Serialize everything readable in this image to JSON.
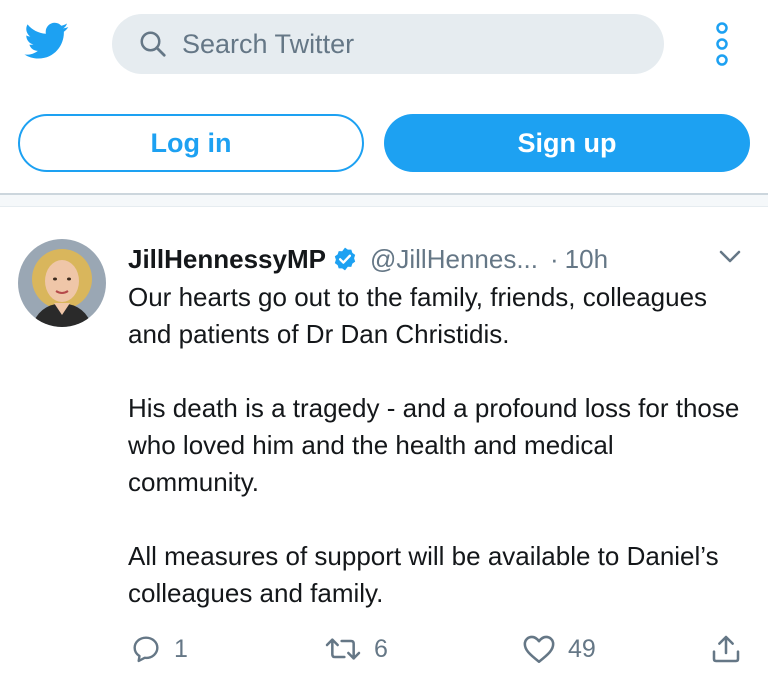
{
  "colors": {
    "brand": "#1da1f2",
    "text": "#14171a",
    "secondary": "#657786",
    "search_bg": "#e6ecf0"
  },
  "topbar": {
    "logo_icon": "twitter-bird-icon",
    "search_placeholder": "Search Twitter",
    "more_icon": "more-vertical-icon"
  },
  "auth": {
    "login_label": "Log in",
    "signup_label": "Sign up"
  },
  "tweet": {
    "display_name": "JillHennessyMP",
    "verified_icon": "verified-badge-icon",
    "handle": "@JillHennes...",
    "separator": "·",
    "time": "10h",
    "caret_icon": "chevron-down-icon",
    "paragraphs": [
      "Our hearts go out to the family, friends, colleagues and patients of Dr Dan Christidis.",
      "His death is a tragedy - and a profound loss for those who loved him and the health and medical community.",
      "All measures of support will be available to Daniel’s colleagues and family."
    ],
    "actions": {
      "reply_count": "1",
      "retweet_count": "6",
      "like_count": "49"
    }
  }
}
